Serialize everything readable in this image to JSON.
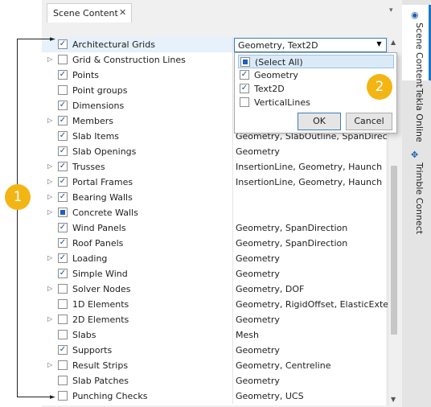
{
  "panel": {
    "tab_label": "Scene Content",
    "close_glyph": "✕",
    "menu_glyph": "▾"
  },
  "rows": [
    {
      "name": "Architectural Grids",
      "value": "Geometry, Text2D",
      "state": "checked",
      "expander": false,
      "selected": true
    },
    {
      "name": "Grid & Construction Lines",
      "value": "",
      "state": "unchecked",
      "expander": true
    },
    {
      "name": "Points",
      "value": "",
      "state": "checked",
      "expander": false
    },
    {
      "name": "Point groups",
      "value": "",
      "state": "unchecked",
      "expander": false
    },
    {
      "name": "Dimensions",
      "value": "",
      "state": "checked",
      "expander": false
    },
    {
      "name": "Members",
      "value": "",
      "state": "checked",
      "expander": true
    },
    {
      "name": "Slab Items",
      "value": "Geometry, SlabOutline, SpanDirection",
      "state": "checked",
      "expander": false
    },
    {
      "name": "Slab Openings",
      "value": "Geometry",
      "state": "checked",
      "expander": false
    },
    {
      "name": "Trusses",
      "value": "InsertionLine, Geometry, Haunch",
      "state": "checked",
      "expander": true
    },
    {
      "name": "Portal Frames",
      "value": "InsertionLine, Geometry, Haunch",
      "state": "checked",
      "expander": true
    },
    {
      "name": "Bearing Walls",
      "value": "",
      "state": "checked",
      "expander": true
    },
    {
      "name": "Concrete Walls",
      "value": "",
      "state": "partial",
      "expander": true
    },
    {
      "name": "Wind Panels",
      "value": "Geometry, SpanDirection",
      "state": "checked",
      "expander": false
    },
    {
      "name": "Roof Panels",
      "value": "Geometry, SpanDirection",
      "state": "checked",
      "expander": false
    },
    {
      "name": "Loading",
      "value": "Geometry",
      "state": "checked",
      "expander": true
    },
    {
      "name": "Simple Wind",
      "value": "Geometry",
      "state": "checked",
      "expander": false
    },
    {
      "name": "Solver Nodes",
      "value": "Geometry, DOF",
      "state": "unchecked",
      "expander": true
    },
    {
      "name": "1D Elements",
      "value": "Geometry, RigidOffset, ElasticExte…",
      "state": "unchecked",
      "expander": false
    },
    {
      "name": "2D Elements",
      "value": "Geometry",
      "state": "unchecked",
      "expander": true
    },
    {
      "name": "Slabs",
      "value": "Mesh",
      "state": "unchecked",
      "expander": false
    },
    {
      "name": "Supports",
      "value": "Geometry",
      "state": "checked",
      "expander": false
    },
    {
      "name": "Result Strips",
      "value": "Geometry, Centreline",
      "state": "unchecked",
      "expander": true
    },
    {
      "name": "Slab Patches",
      "value": "Geometry",
      "state": "unchecked",
      "expander": false
    },
    {
      "name": "Punching Checks",
      "value": "Geometry, UCS",
      "state": "unchecked",
      "expander": false
    }
  ],
  "dropdown": {
    "current_value": "Geometry, Text2D",
    "options": [
      {
        "label": "(Select All)",
        "state": "partial",
        "highlighted": true
      },
      {
        "label": "Geometry",
        "state": "checked"
      },
      {
        "label": "Text2D",
        "state": "checked"
      },
      {
        "label": "VerticalLines",
        "state": "unchecked"
      }
    ],
    "ok_label": "OK",
    "cancel_label": "Cancel"
  },
  "side_tabs": [
    {
      "label": "Scene Content",
      "icon": "eye-icon",
      "active": true
    },
    {
      "label": "Tekla Online",
      "icon": "",
      "active": false
    },
    {
      "label": "Trimble Connect",
      "icon": "trimble-connect-icon",
      "active": false
    }
  ],
  "callouts": {
    "badge1": "1",
    "badge2": "2"
  },
  "colors": {
    "accent": "#1e78c8",
    "callout": "#f2b514",
    "selection": "#e6f1fb"
  }
}
